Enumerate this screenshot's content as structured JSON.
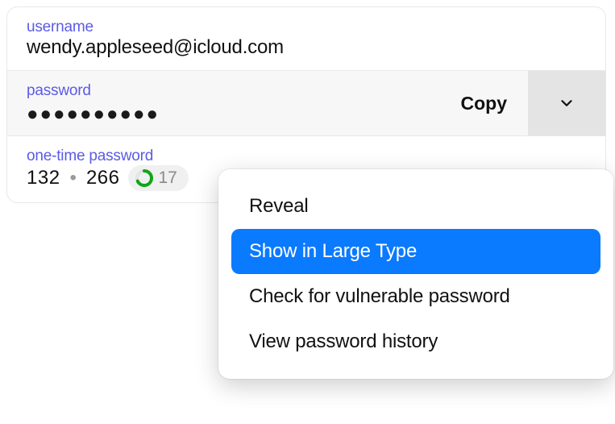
{
  "fields": {
    "username": {
      "label": "username",
      "value": "wendy.appleseed@icloud.com"
    },
    "password": {
      "label": "password",
      "masked": "●●●●●●●●●●",
      "copy_label": "Copy"
    },
    "otp": {
      "label": "one-time password",
      "code_a": "132",
      "code_b": "266",
      "timer": "17"
    }
  },
  "dropdown": {
    "items": [
      {
        "label": "Reveal",
        "highlighted": false
      },
      {
        "label": "Show in Large Type",
        "highlighted": true
      },
      {
        "label": "Check for vulnerable password",
        "highlighted": false
      },
      {
        "label": "View password history",
        "highlighted": false
      }
    ]
  },
  "colors": {
    "accent": "#0a7aff",
    "label": "#5b5be6",
    "timer_ring": "#10a616"
  }
}
